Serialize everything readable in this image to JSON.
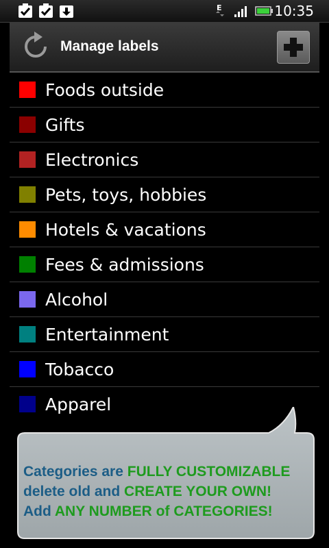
{
  "status_bar": {
    "time": "10:35",
    "network_type": "E",
    "icons": [
      "check-notification-icon",
      "check-notification-icon",
      "download-icon",
      "network-e-icon",
      "signal-icon",
      "battery-icon"
    ]
  },
  "header": {
    "title": "Manage labels",
    "refresh_icon": "refresh-icon",
    "add_icon": "plus-icon"
  },
  "labels": [
    {
      "name": "Foods outside",
      "color": "#ff0000"
    },
    {
      "name": "Gifts",
      "color": "#8b0000"
    },
    {
      "name": "Electronics",
      "color": "#b22222"
    },
    {
      "name": "Pets, toys, hobbies",
      "color": "#808000"
    },
    {
      "name": "Hotels & vacations",
      "color": "#ff8c00"
    },
    {
      "name": "Fees & admissions",
      "color": "#008000"
    },
    {
      "name": "Alcohol",
      "color": "#7b68ee"
    },
    {
      "name": "Entertainment",
      "color": "#008080"
    },
    {
      "name": "Tobacco",
      "color": "#0000ff"
    },
    {
      "name": "Apparel",
      "color": "#00008b"
    }
  ],
  "callout": {
    "line1_a": "Categories are ",
    "line1_b": "FULLY CUSTOMIZABLE",
    "line2_a": "delete old and ",
    "line2_b": "CREATE YOUR OWN!",
    "line3_a": "Add ",
    "line3_b": "ANY NUMBER of CATEGORIES!"
  }
}
